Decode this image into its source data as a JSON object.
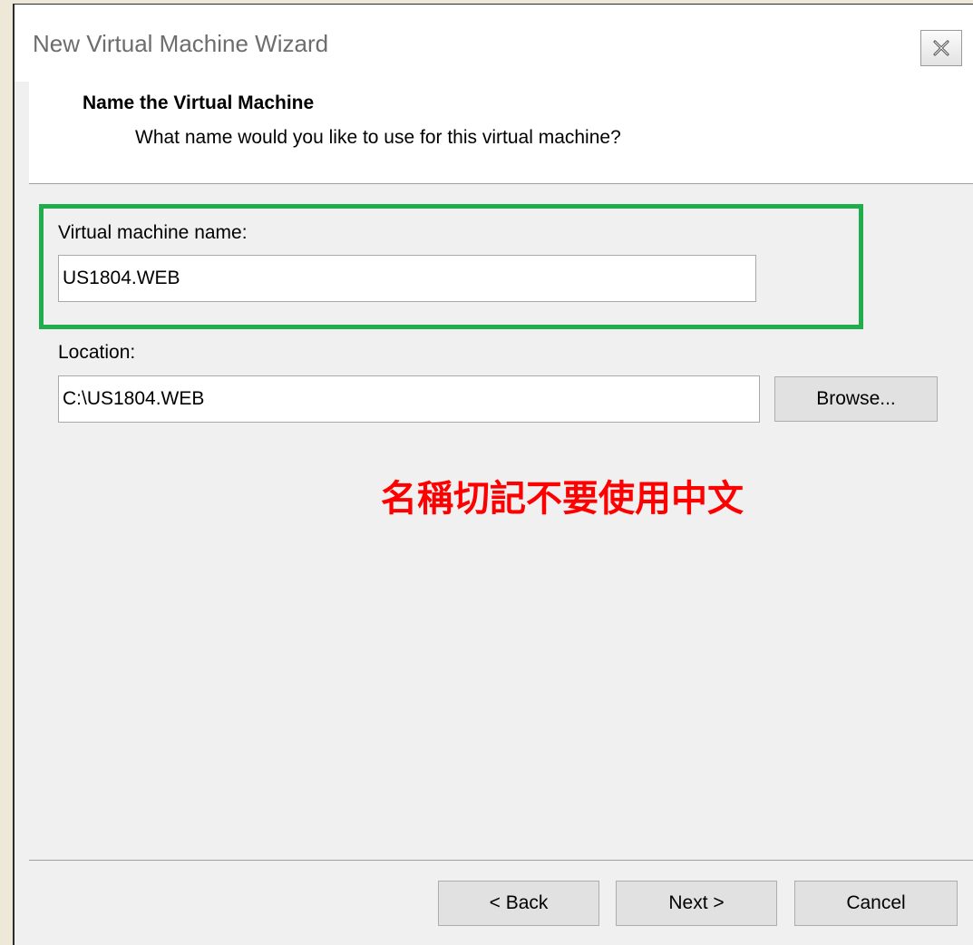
{
  "window": {
    "title": "New Virtual Machine Wizard"
  },
  "header": {
    "title": "Name the Virtual Machine",
    "subtitle": "What name would you like to use for this virtual machine?"
  },
  "form": {
    "name_label": "Virtual machine name:",
    "name_value": "US1804.WEB",
    "location_label": "Location:",
    "location_value": "C:\\US1804.WEB",
    "browse_label": "Browse..."
  },
  "annotation": {
    "warning_text": "名稱切記不要使用中文",
    "warning_color": "#ff0000",
    "highlight_color": "#1fae4b"
  },
  "footer": {
    "back_label": "< Back",
    "next_label": "Next >",
    "cancel_label": "Cancel"
  },
  "icons": {
    "close": "close-icon"
  }
}
